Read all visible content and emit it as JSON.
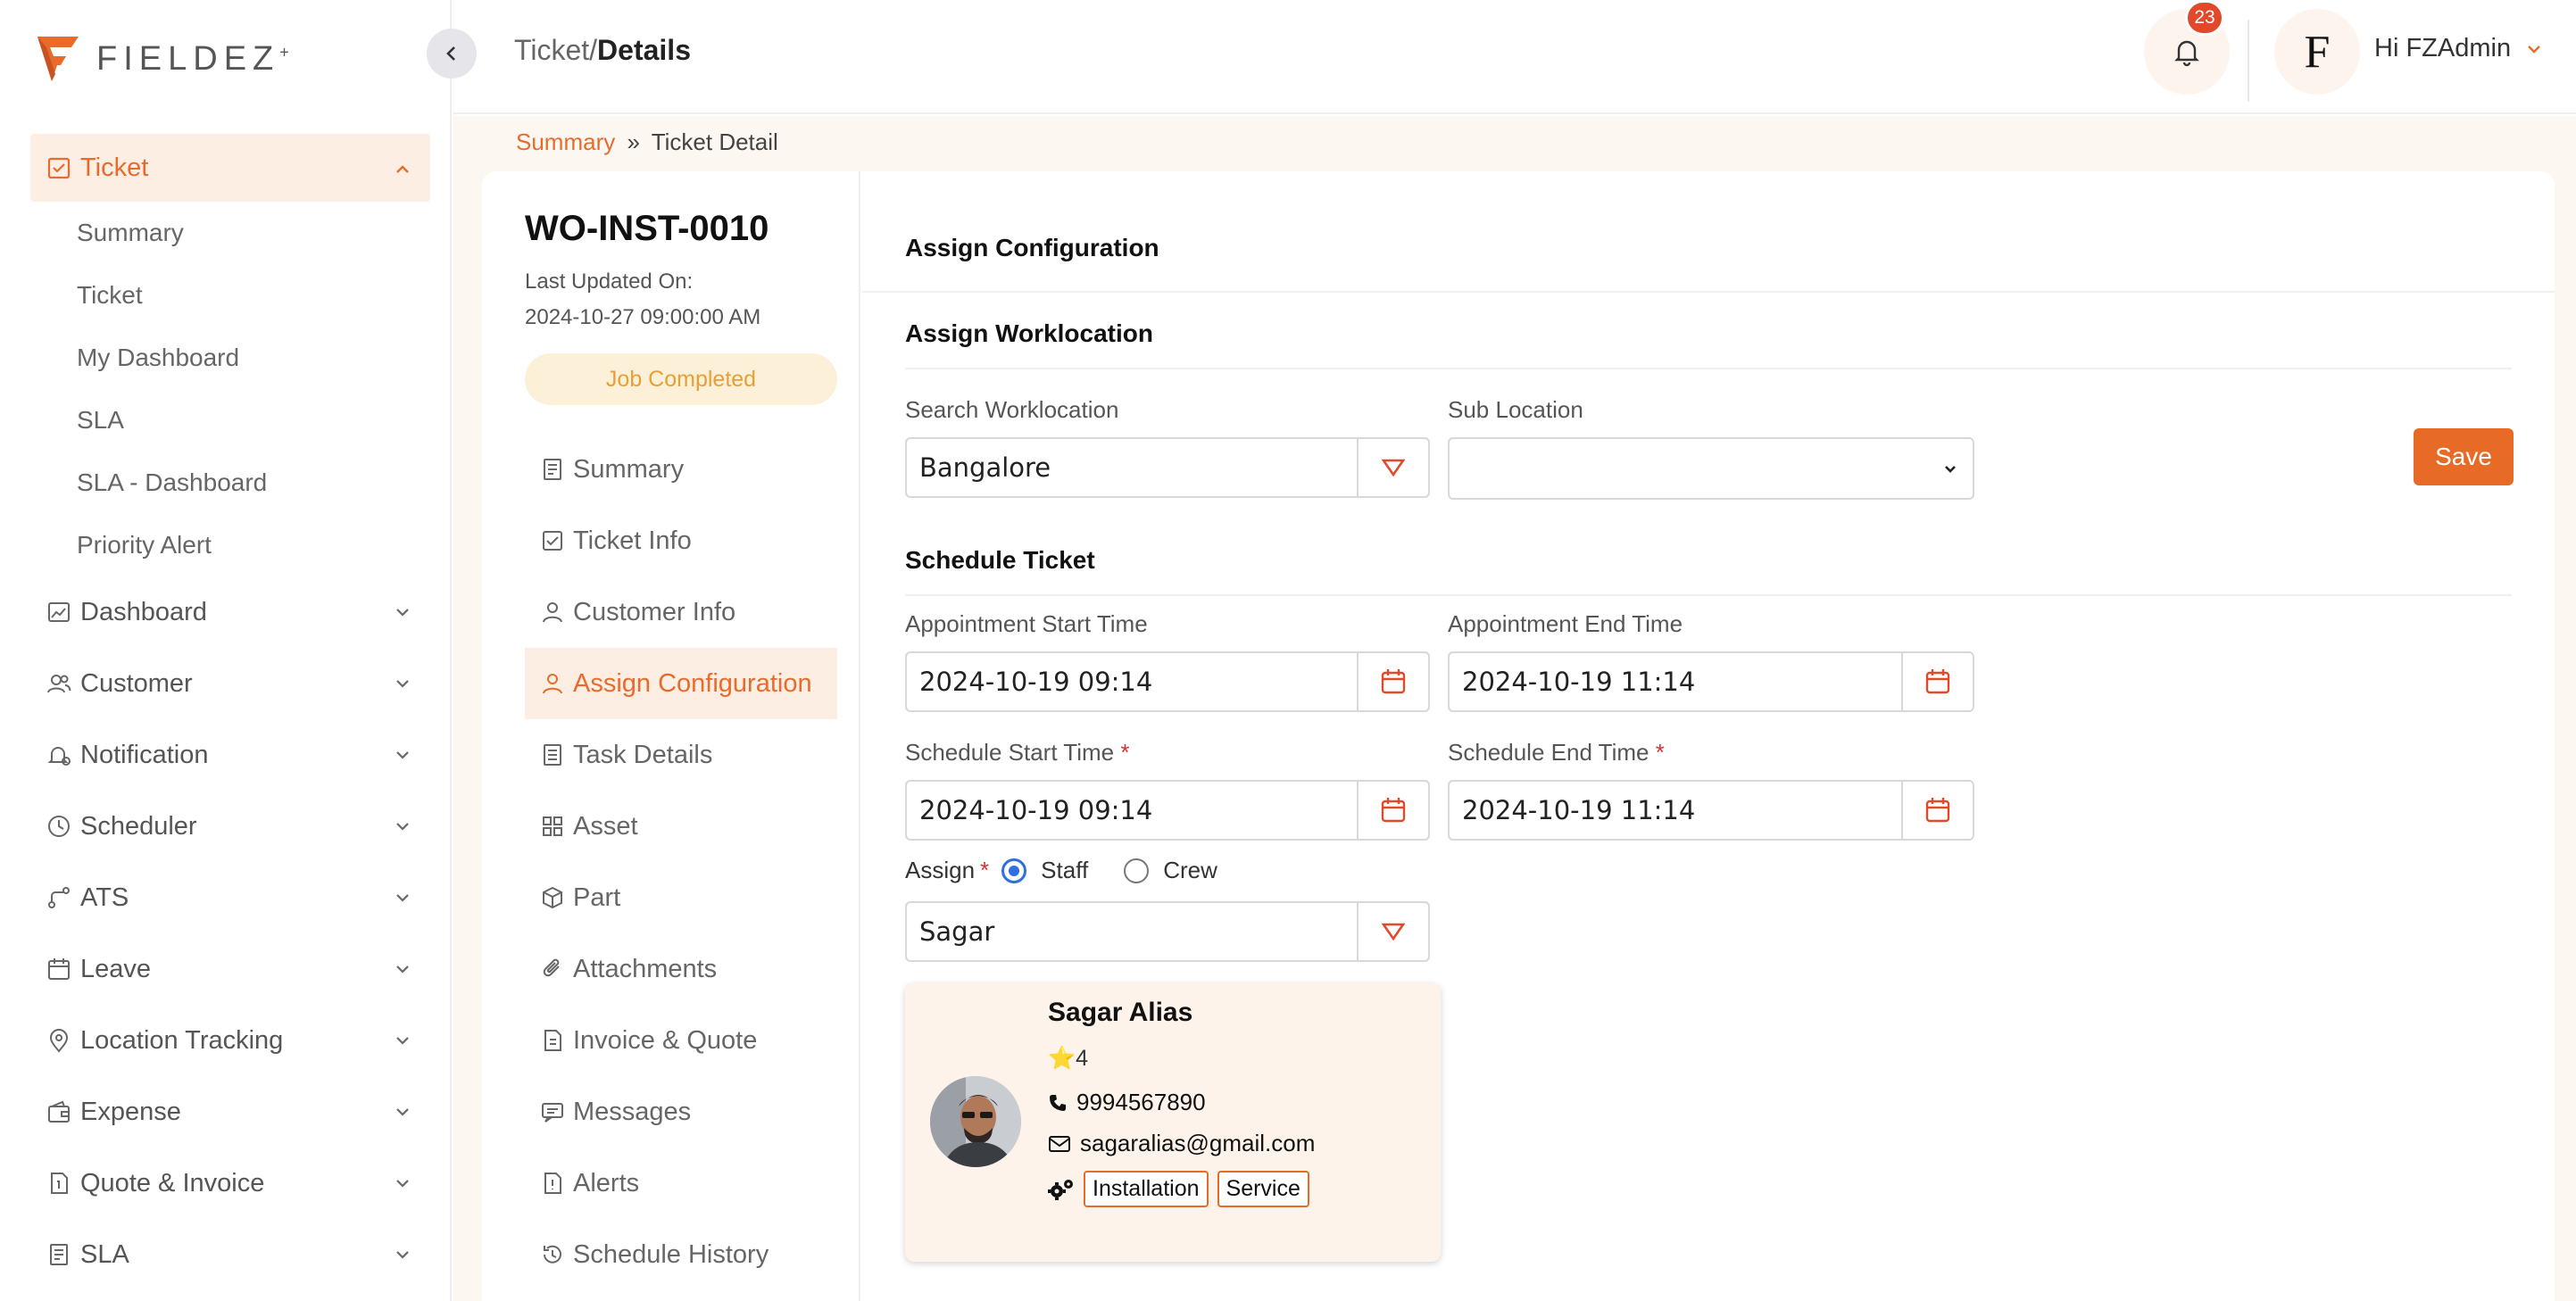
{
  "brand": {
    "name": "FIELDEZ",
    "mark": "+"
  },
  "sidebar": {
    "items": [
      {
        "label": "Ticket",
        "icon": "ticket-icon",
        "active": true,
        "children": [
          "Summary",
          "Ticket",
          "My Dashboard",
          "SLA",
          "SLA - Dashboard",
          "Priority Alert"
        ]
      },
      {
        "label": "Dashboard",
        "icon": "dashboard-icon"
      },
      {
        "label": "Customer",
        "icon": "customer-icon"
      },
      {
        "label": "Notification",
        "icon": "notification-icon"
      },
      {
        "label": "Scheduler",
        "icon": "clock-icon"
      },
      {
        "label": "ATS",
        "icon": "route-icon"
      },
      {
        "label": "Leave",
        "icon": "calendar-icon"
      },
      {
        "label": "Location Tracking",
        "icon": "location-pin-icon"
      },
      {
        "label": "Expense",
        "icon": "wallet-icon"
      },
      {
        "label": "Quote & Invoice",
        "icon": "invoice-icon"
      },
      {
        "label": "SLA",
        "icon": "sla-icon"
      }
    ]
  },
  "header": {
    "title_prefix": "Ticket/",
    "title_main": "Details",
    "notification_count": "23",
    "avatar_letter": "F",
    "greeting": "Hi FZAdmin"
  },
  "breadcrumb": {
    "link": "Summary",
    "sep": "»",
    "current": "Ticket Detail"
  },
  "ticket": {
    "id": "WO-INST-0010",
    "updated_label": "Last Updated On:",
    "updated_value": "2024-10-27 09:00:00 AM",
    "status": "Job Completed"
  },
  "tabs": [
    {
      "label": "Summary",
      "icon": "document-icon"
    },
    {
      "label": "Ticket Info",
      "icon": "ticket-check-icon"
    },
    {
      "label": "Customer Info",
      "icon": "user-icon"
    },
    {
      "label": "Assign Configuration",
      "icon": "user-assign-icon",
      "active": true
    },
    {
      "label": "Task Details",
      "icon": "list-icon"
    },
    {
      "label": "Asset",
      "icon": "grid-icon"
    },
    {
      "label": "Part",
      "icon": "box-icon"
    },
    {
      "label": "Attachments",
      "icon": "paperclip-icon"
    },
    {
      "label": "Invoice & Quote",
      "icon": "invoice-icon"
    },
    {
      "label": "Messages",
      "icon": "message-icon"
    },
    {
      "label": "Alerts",
      "icon": "alert-icon"
    },
    {
      "label": "Schedule History",
      "icon": "history-icon"
    }
  ],
  "assign": {
    "heading": "Assign Configuration",
    "worklocation_heading": "Assign Worklocation",
    "search_label": "Search Worklocation",
    "search_value": "Bangalore",
    "sublocation_label": "Sub Location",
    "sublocation_value": "",
    "save_label": "Save",
    "schedule_heading": "Schedule Ticket",
    "appt_start_label": "Appointment Start Time",
    "appt_start_value": "2024-10-19 09:14",
    "appt_end_label": "Appointment End Time",
    "appt_end_value": "2024-10-19 11:14",
    "sched_start_label": "Schedule Start Time",
    "sched_start_value": "2024-10-19 09:14",
    "sched_end_label": "Schedule End Time",
    "sched_end_value": "2024-10-19 11:14",
    "required_mark": "*",
    "assign_label": "Assign",
    "radio_staff": "Staff",
    "radio_crew": "Crew",
    "assignee_value": "Sagar"
  },
  "staff": {
    "name": "Sagar Alias",
    "rating": "4",
    "phone": "9994567890",
    "email": "sagaralias@gmail.com",
    "skills": [
      "Installation",
      "Service"
    ]
  },
  "colors": {
    "accent": "#e96b2b",
    "accent_bg": "#fdeee4",
    "status_text": "#e6a035",
    "status_bg": "#fdf0d8"
  }
}
